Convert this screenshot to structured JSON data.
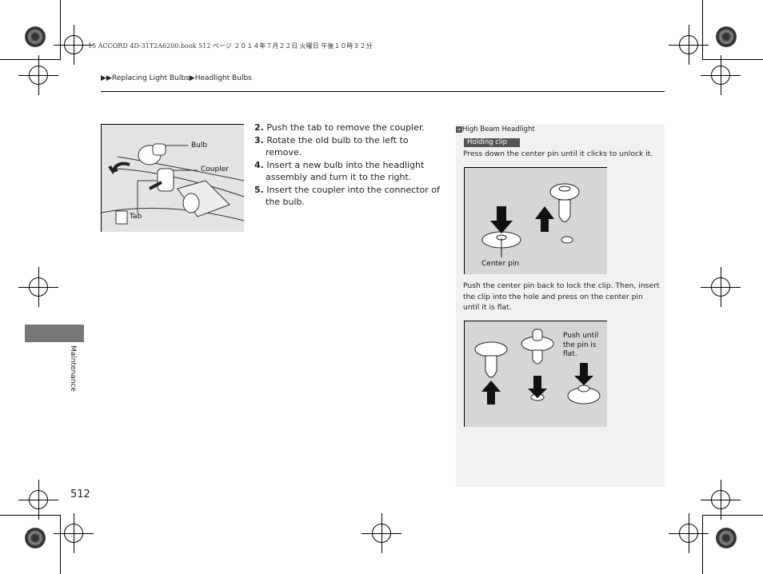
{
  "print_meta": "15 ACCORD 4D-31T2A6200.book  512 ページ  ２０１４年７月２２日  火曜日  午後１０時３２分",
  "breadcrumb": {
    "marker": "▶▶",
    "items": [
      "Replacing Light Bulbs",
      "Headlight Bulbs"
    ],
    "separator": "▶"
  },
  "side_tab": {
    "label": "Maintenance",
    "color": "#777777"
  },
  "page_number": "512",
  "figure1": {
    "labels": {
      "bulb": "Bulb",
      "coupler": "Coupler",
      "tab": "Tab"
    }
  },
  "steps": [
    {
      "num": "2.",
      "text": "Push the tab to remove the coupler."
    },
    {
      "num": "3.",
      "text": "Rotate the old bulb to the left to remove."
    },
    {
      "num": "4.",
      "text": "Insert a new bulb into the headlight assembly and turn it to the right."
    },
    {
      "num": "5.",
      "text": "Insert the coupler into the connector of the bulb."
    }
  ],
  "note": {
    "icon": "double-chevron-icon",
    "title": "High Beam Headlight",
    "badge": "Holding clip",
    "text1": "Press down the center pin until it clicks to unlock it.",
    "figure2_label": "Center pin",
    "text2": "Push the center pin back to lock the clip. Then, insert the clip into the hole and press on the center pin until it is flat.",
    "figure3_label": "Push until the pin is flat."
  }
}
